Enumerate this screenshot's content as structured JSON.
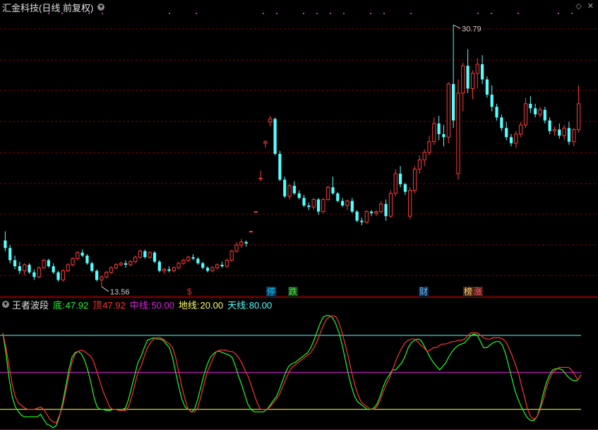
{
  "header": {
    "title": "汇金科技(日线 前复权)"
  },
  "indicator": {
    "name": "王者波段",
    "items": [
      {
        "label": "底:",
        "value": "47.92",
        "color": "#22ff22"
      },
      {
        "label": "顶",
        "value": "47.92",
        "color": "#ff3333"
      },
      {
        "label": "中线:",
        "value": "50.00",
        "color": "#dd22dd"
      },
      {
        "label": "地线:",
        "value": "20.00",
        "color": "#ffff66"
      },
      {
        "label": "天线:",
        "value": "80.00",
        "color": "#55ffff"
      }
    ]
  },
  "annotations": {
    "high_label": "30.79",
    "low_label": "13.56"
  },
  "badges": [
    {
      "text": "$",
      "color": "#ff2020",
      "bg": "transparent"
    },
    {
      "text": "停",
      "color": "#00ccff",
      "bg": "#1a3a5a"
    },
    {
      "text": "跌",
      "color": "#44ff44",
      "bg": "#1a3a1a"
    },
    {
      "text": "财",
      "color": "#66bbff",
      "bg": "#1a2a4a"
    },
    {
      "text": "榜",
      "color": "#ffcc66",
      "bg": "#4a2a1a"
    },
    {
      "text": "涨",
      "color": "#ff6666",
      "bg": "#4a1a1a"
    }
  ],
  "colors": {
    "up": "#ff3b3b",
    "down": "#54ffff",
    "grid": "#7a0000",
    "axis_line": "#a00000",
    "dot": "#cc33cc"
  },
  "chart_data": {
    "type": "candlestick",
    "price_range": [
      13.0,
      31.5
    ],
    "candles": [
      [
        16.6,
        17.2,
        15.9,
        16.1
      ],
      [
        16.1,
        16.3,
        15.1,
        15.3
      ],
      [
        15.3,
        15.6,
        14.7,
        14.9
      ],
      [
        14.9,
        15.2,
        14.4,
        14.6
      ],
      [
        14.6,
        15.1,
        14.3,
        15.0
      ],
      [
        15.0,
        15.1,
        14.4,
        14.5
      ],
      [
        14.5,
        14.7,
        14.0,
        14.2
      ],
      [
        14.2,
        14.9,
        14.1,
        14.8
      ],
      [
        14.8,
        15.4,
        14.7,
        15.3
      ],
      [
        15.3,
        15.4,
        14.8,
        14.9
      ],
      [
        14.9,
        15.1,
        14.4,
        14.5
      ],
      [
        14.5,
        14.6,
        13.9,
        14.0
      ],
      [
        14.0,
        14.7,
        13.9,
        14.6
      ],
      [
        14.6,
        15.1,
        14.5,
        15.0
      ],
      [
        15.0,
        15.5,
        14.9,
        15.4
      ],
      [
        15.4,
        15.9,
        15.3,
        15.8
      ],
      [
        15.8,
        16.0,
        15.5,
        15.6
      ],
      [
        15.6,
        15.7,
        15.0,
        15.1
      ],
      [
        15.1,
        15.2,
        14.5,
        14.6
      ],
      [
        14.6,
        14.7,
        13.9,
        14.0
      ],
      [
        14.0,
        14.3,
        13.56,
        14.2
      ],
      [
        14.2,
        14.6,
        14.1,
        14.5
      ],
      [
        14.5,
        14.9,
        14.4,
        14.8
      ],
      [
        14.8,
        15.1,
        14.7,
        15.0
      ],
      [
        15.0,
        15.2,
        14.9,
        15.1
      ],
      [
        15.1,
        15.3,
        14.8,
        15.0
      ],
      [
        15.0,
        15.3,
        14.9,
        15.2
      ],
      [
        15.2,
        15.6,
        15.1,
        15.5
      ],
      [
        15.5,
        16.0,
        15.4,
        15.9
      ],
      [
        15.9,
        16.0,
        15.4,
        15.5
      ],
      [
        15.5,
        15.9,
        15.4,
        15.8
      ],
      [
        15.8,
        15.9,
        15.1,
        15.2
      ],
      [
        15.2,
        15.3,
        14.5,
        14.6
      ],
      [
        14.6,
        14.8,
        14.4,
        14.7
      ],
      [
        14.7,
        14.9,
        14.5,
        14.6
      ],
      [
        14.6,
        14.9,
        14.5,
        14.8
      ],
      [
        14.8,
        15.2,
        14.7,
        15.1
      ],
      [
        15.1,
        15.4,
        15.0,
        15.3
      ],
      [
        15.3,
        15.6,
        15.2,
        15.5
      ],
      [
        15.5,
        15.7,
        15.3,
        15.4
      ],
      [
        15.4,
        15.5,
        15.0,
        15.1
      ],
      [
        15.1,
        15.2,
        14.7,
        14.8
      ],
      [
        14.8,
        14.9,
        14.5,
        14.6
      ],
      [
        14.6,
        14.9,
        14.5,
        14.8
      ],
      [
        14.8,
        15.1,
        14.7,
        15.0
      ],
      [
        15.0,
        15.2,
        14.8,
        14.9
      ],
      [
        14.9,
        15.4,
        14.8,
        15.3
      ],
      [
        15.3,
        16.0,
        15.2,
        15.9
      ],
      [
        15.9,
        16.5,
        15.8,
        16.3
      ],
      [
        16.3,
        16.7,
        16.1,
        16.5
      ],
      [
        16.5,
        16.6,
        16.2,
        16.4
      ],
      [
        17.2,
        17.2,
        17.2,
        17.2
      ],
      [
        18.5,
        18.5,
        18.5,
        18.5
      ],
      [
        20.7,
        21.2,
        20.5,
        20.7
      ],
      [
        23.0,
        23.2,
        22.7,
        23.1
      ],
      [
        24.4,
        24.8,
        24.1,
        24.6
      ],
      [
        24.6,
        24.7,
        22.2,
        22.3
      ],
      [
        22.3,
        22.5,
        20.5,
        20.6
      ],
      [
        20.6,
        20.8,
        19.4,
        19.5
      ],
      [
        19.5,
        20.3,
        19.3,
        20.2
      ],
      [
        20.2,
        20.5,
        19.6,
        19.7
      ],
      [
        19.7,
        19.9,
        19.3,
        19.4
      ],
      [
        19.4,
        19.6,
        18.8,
        18.9
      ],
      [
        18.9,
        19.1,
        18.6,
        18.8
      ],
      [
        18.8,
        19.4,
        18.6,
        19.3
      ],
      [
        19.3,
        19.4,
        18.3,
        18.5
      ],
      [
        18.5,
        19.4,
        18.4,
        19.3
      ],
      [
        19.3,
        20.2,
        19.2,
        20.1
      ],
      [
        20.1,
        20.8,
        19.6,
        19.7
      ],
      [
        19.7,
        19.8,
        19.1,
        19.2
      ],
      [
        19.2,
        19.4,
        18.8,
        18.9
      ],
      [
        18.9,
        19.3,
        18.6,
        19.2
      ],
      [
        19.2,
        19.4,
        18.4,
        18.5
      ],
      [
        18.5,
        18.6,
        17.8,
        17.9
      ],
      [
        17.9,
        18.1,
        17.6,
        17.8
      ],
      [
        17.8,
        18.6,
        17.7,
        18.5
      ],
      [
        18.5,
        18.6,
        18.2,
        18.4
      ],
      [
        18.4,
        18.6,
        18.2,
        18.5
      ],
      [
        18.5,
        19.2,
        18.4,
        19.0
      ],
      [
        19.0,
        19.3,
        17.9,
        18.2
      ],
      [
        18.2,
        19.9,
        18.1,
        19.7
      ],
      [
        19.7,
        21.3,
        19.5,
        21.0
      ],
      [
        21.0,
        21.5,
        20.1,
        20.3
      ],
      [
        20.3,
        20.4,
        19.6,
        19.8
      ],
      [
        18.2,
        20.1,
        18.0,
        19.9
      ],
      [
        19.9,
        21.5,
        19.7,
        21.3
      ],
      [
        21.3,
        22.2,
        21.0,
        21.9
      ],
      [
        21.9,
        22.6,
        21.5,
        22.4
      ],
      [
        22.4,
        23.5,
        22.2,
        23.1
      ],
      [
        23.1,
        24.7,
        22.9,
        24.3
      ],
      [
        24.3,
        24.8,
        23.2,
        23.6
      ],
      [
        23.6,
        24.2,
        22.8,
        23.4
      ],
      [
        23.4,
        27.0,
        23.0,
        26.9
      ],
      [
        26.9,
        30.79,
        24.0,
        24.5
      ],
      [
        21.0,
        27.2,
        20.6,
        26.3
      ],
      [
        26.3,
        28.3,
        25.1,
        28.1
      ],
      [
        28.1,
        29.2,
        26.3,
        26.6
      ],
      [
        26.6,
        27.8,
        25.9,
        27.6
      ],
      [
        27.6,
        28.6,
        26.6,
        28.2
      ],
      [
        28.2,
        28.8,
        26.9,
        27.2
      ],
      [
        27.2,
        27.4,
        26.0,
        26.2
      ],
      [
        26.2,
        26.8,
        25.1,
        25.4
      ],
      [
        25.4,
        25.6,
        24.5,
        24.7
      ],
      [
        24.7,
        24.9,
        23.8,
        24.0
      ],
      [
        24.0,
        24.4,
        23.2,
        23.4
      ],
      [
        23.4,
        23.6,
        22.8,
        23.0
      ],
      [
        23.0,
        23.8,
        22.7,
        23.6
      ],
      [
        23.6,
        24.4,
        23.4,
        24.2
      ],
      [
        24.2,
        26.0,
        24.0,
        25.6
      ],
      [
        25.6,
        26.1,
        25.0,
        25.3
      ],
      [
        25.3,
        25.6,
        24.7,
        24.9
      ],
      [
        24.9,
        25.4,
        24.7,
        25.2
      ],
      [
        25.2,
        25.4,
        24.3,
        24.5
      ],
      [
        24.5,
        24.7,
        23.6,
        23.8
      ],
      [
        23.8,
        24.1,
        23.5,
        23.9
      ],
      [
        23.9,
        24.3,
        23.3,
        23.5
      ],
      [
        23.5,
        24.2,
        23.2,
        24.0
      ],
      [
        24.0,
        24.4,
        22.9,
        23.1
      ],
      [
        23.1,
        24.0,
        22.8,
        23.9
      ],
      [
        23.9,
        26.8,
        23.7,
        25.6
      ]
    ],
    "indicator_lines": {
      "mid": 50,
      "low": 20,
      "high": 80,
      "range": [
        5,
        100
      ]
    },
    "top_line": [
      82,
      70,
      55,
      40,
      30,
      25,
      23,
      21,
      20,
      20,
      20,
      21,
      22,
      20,
      16,
      12,
      10,
      9,
      15,
      22,
      34,
      47,
      58,
      65,
      67,
      68,
      67,
      65,
      63,
      58,
      50,
      42,
      34,
      28,
      22,
      20,
      20,
      19,
      19,
      19,
      22,
      30,
      40,
      50,
      55,
      63,
      70,
      74,
      77,
      78,
      78,
      77,
      75,
      73,
      70,
      62,
      50,
      38,
      28,
      20,
      18,
      18,
      21,
      30,
      40,
      50,
      56,
      62,
      67,
      68,
      68,
      68,
      67,
      67,
      65,
      62,
      58,
      52,
      47,
      40,
      32,
      25,
      20,
      20,
      20,
      22,
      25,
      28,
      32,
      38,
      44,
      50,
      54,
      56,
      58,
      60,
      62,
      64,
      66,
      70,
      75,
      82,
      88,
      93,
      95,
      96,
      95,
      90,
      82,
      72,
      62,
      50,
      40,
      32,
      26,
      24,
      22,
      20,
      20,
      22,
      27,
      34,
      40,
      45,
      52,
      59,
      65,
      70,
      74,
      76,
      77,
      77,
      75,
      72,
      70,
      67,
      68,
      70,
      70,
      72,
      73,
      73,
      74,
      75,
      75,
      76,
      76,
      77,
      80,
      82,
      82,
      82,
      80,
      78,
      77,
      77,
      78,
      78,
      78,
      77,
      75,
      70,
      64,
      57,
      50,
      40,
      30,
      20,
      14,
      12,
      14,
      20,
      28,
      38,
      45,
      50,
      52,
      54,
      54,
      54,
      54,
      52,
      48,
      44,
      47.92
    ],
    "bottom_line": [
      82,
      65,
      45,
      30,
      22,
      18,
      15,
      14,
      14,
      14,
      14,
      14,
      16,
      12,
      8,
      7,
      5,
      7,
      14,
      25,
      38,
      52,
      62,
      66,
      67,
      65,
      60,
      52,
      42,
      30,
      22,
      20,
      20,
      19,
      19,
      20,
      20,
      20,
      20,
      21,
      28,
      38,
      48,
      58,
      63,
      70,
      76,
      77,
      78,
      77,
      77,
      76,
      73,
      70,
      62,
      50,
      38,
      28,
      22,
      20,
      18,
      20,
      28,
      38,
      48,
      56,
      62,
      65,
      67,
      67,
      66,
      65,
      64,
      62,
      55,
      47,
      40,
      32,
      24,
      20,
      18,
      18,
      18,
      18,
      20,
      23,
      27,
      30,
      36,
      43,
      50,
      55,
      57,
      58,
      60,
      62,
      64,
      66,
      70,
      76,
      83,
      90,
      95,
      96,
      96,
      94,
      89,
      82,
      72,
      60,
      48,
      38,
      30,
      26,
      24,
      22,
      20,
      20,
      21,
      24,
      30,
      38,
      44,
      48,
      52,
      52,
      55,
      58,
      63,
      70,
      74,
      76,
      77,
      76,
      72,
      67,
      62,
      58,
      55,
      52,
      55,
      58,
      63,
      67,
      70,
      72,
      73,
      74,
      77,
      80,
      81,
      80,
      75,
      70,
      70,
      72,
      74,
      75,
      75,
      72,
      65,
      55,
      45,
      35,
      28,
      22,
      17,
      13,
      11,
      11,
      14,
      22,
      33,
      42,
      48,
      52,
      53,
      53,
      52,
      49,
      46,
      44,
      43,
      44,
      47.92
    ]
  }
}
